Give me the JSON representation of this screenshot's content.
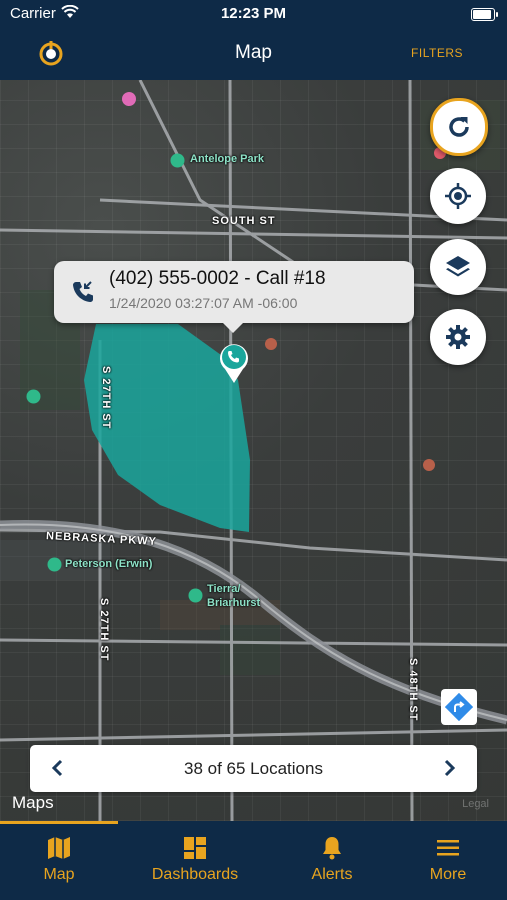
{
  "status_bar": {
    "carrier": "Carrier",
    "time": "12:23 PM"
  },
  "nav": {
    "title": "Map",
    "filters_label": "FILTERS"
  },
  "map": {
    "labels": {
      "antelope_park": "Antelope Park",
      "south_st": "SOUTH ST",
      "s27th_top": "S 27TH ST",
      "nebraska_pkwy": "NEBRASKA PKWY",
      "peterson": "Peterson (Erwin)",
      "tierra": "Tierra/",
      "briarhurst": "Briarhurst",
      "s27th_bottom": "S 27TH ST",
      "s48th": "S 48TH ST"
    },
    "legal": "Legal",
    "attribution": "Maps"
  },
  "callout": {
    "title": "(402) 555-0002 - Call #18",
    "subtitle": "1/24/2020 03:27:07 AM -06:00"
  },
  "location_bar": {
    "text": "38 of 65 Locations"
  },
  "tabs": [
    {
      "label": "Map",
      "icon": "map-icon"
    },
    {
      "label": "Dashboards",
      "icon": "dashboards-icon"
    },
    {
      "label": "Alerts",
      "icon": "bell-icon"
    },
    {
      "label": "More",
      "icon": "menu-icon"
    }
  ],
  "colors": {
    "accent": "#e8a41f",
    "navy": "#0e2a47",
    "geofence": "#1aa69c",
    "button_icon": "#1b3a5c"
  }
}
